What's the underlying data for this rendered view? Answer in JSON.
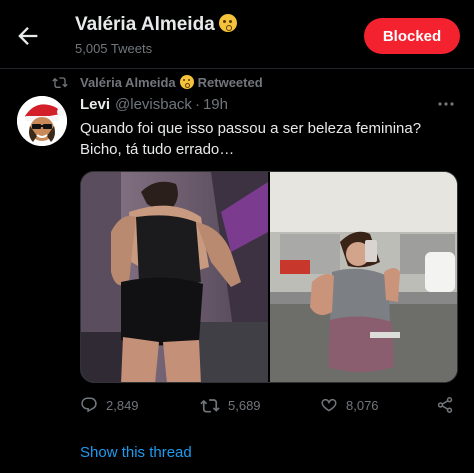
{
  "header": {
    "title": "Valéria Almeida",
    "title_emoji": "hushed-face-emoji",
    "subtitle": "5,005 Tweets",
    "blocked_label": "Blocked",
    "back_icon": "arrow-left-icon"
  },
  "retweet": {
    "by": "Valéria Almeida",
    "label": "Retweeted",
    "icon": "retweet-icon"
  },
  "tweet": {
    "author_name": "Levi",
    "author_handle": "@levisback",
    "separator": "·",
    "time": "19h",
    "text_line1": "Quando foi que isso passou a ser  beleza feminina?",
    "text_line2": "Bicho, tá tudo errado…",
    "media": [
      "gym-photo-back-view",
      "gym-mirror-selfie"
    ]
  },
  "actions": {
    "replies": "2,849",
    "retweets": "5,689",
    "likes": "8,076"
  },
  "footer": {
    "show_thread": "Show this thread"
  },
  "colors": {
    "background": "#000000",
    "text": "#e7e9ea",
    "muted": "#71767b",
    "blocked": "#f4212e",
    "link": "#1d9bf0"
  }
}
